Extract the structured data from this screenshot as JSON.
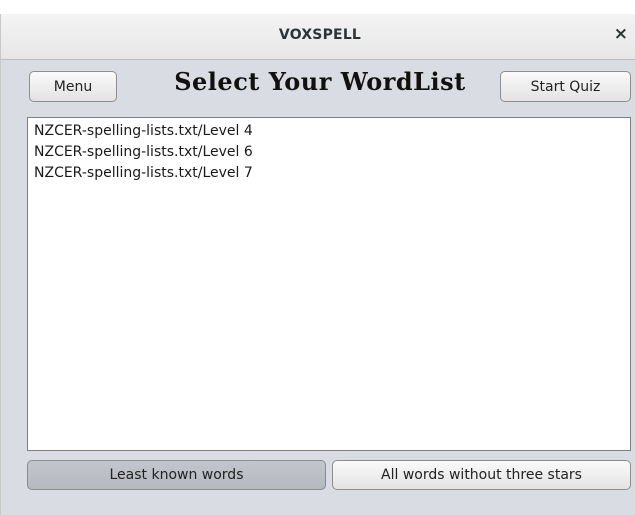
{
  "window": {
    "title": "VOXSPELL",
    "close_icon": "×"
  },
  "toolbar": {
    "menu_label": "Menu",
    "heading": "Select Your WordList",
    "start_label": "Start Quiz"
  },
  "wordlists": [
    "NZCER-spelling-lists.txt/Level 4",
    "NZCER-spelling-lists.txt/Level 6",
    "NZCER-spelling-lists.txt/Level 7"
  ],
  "footer": {
    "least_known_label": "Least known words",
    "all_words_label": "All words without three stars"
  }
}
